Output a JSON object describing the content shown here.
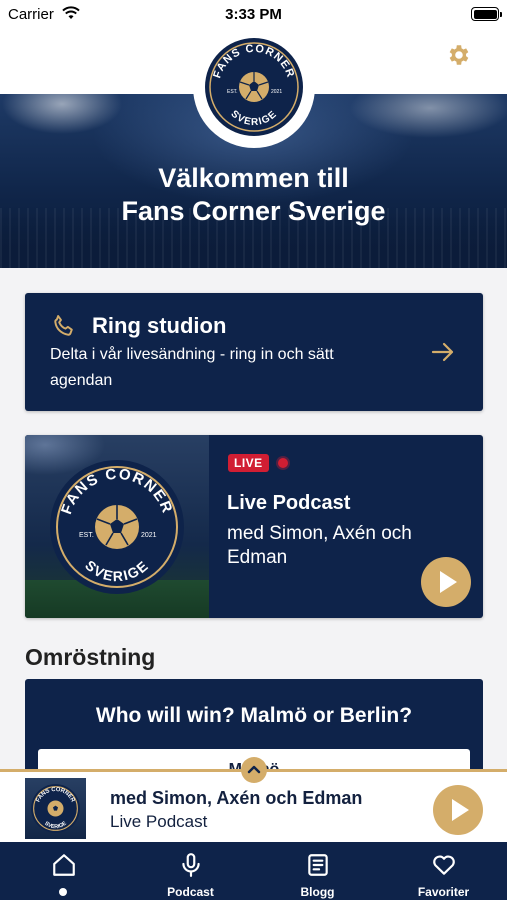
{
  "status_bar": {
    "carrier": "Carrier",
    "time": "3:33 PM"
  },
  "header": {
    "logo_top_text": "FANS CORNER",
    "logo_bottom_text": "SVERIGE",
    "logo_est": "EST.",
    "logo_year": "2021",
    "settings_icon": "gear-icon"
  },
  "hero": {
    "title_line1": "Välkommen till",
    "title_line2": "Fans Corner Sverige"
  },
  "ring_card": {
    "title": "Ring studion",
    "subtitle": "Delta i vår livesändning - ring in och sätt agendan",
    "icon": "phone-icon",
    "arrow_icon": "arrow-right-icon"
  },
  "live_card": {
    "badge": "LIVE",
    "title": "Live Podcast",
    "subtitle": "med Simon, Axén och Edman",
    "play_icon": "play-icon"
  },
  "poll": {
    "section_title": "Omröstning",
    "question": "Who will win? Malmö or Berlin?",
    "first_option": "Malmö"
  },
  "mini_player": {
    "title": "med Simon, Axén och Edman",
    "subtitle": "Live Podcast",
    "expand_icon": "chevron-up-icon"
  },
  "tabs": [
    {
      "label": "",
      "icon": "home-icon",
      "active": true
    },
    {
      "label": "Podcast",
      "icon": "microphone-icon",
      "active": false
    },
    {
      "label": "Blogg",
      "icon": "document-icon",
      "active": false
    },
    {
      "label": "Favoriter",
      "icon": "heart-icon",
      "active": false
    }
  ],
  "colors": {
    "navy": "#0e234a",
    "gold": "#d4ad6a",
    "live_red": "#d11e33",
    "background": "#f3f3f5"
  }
}
